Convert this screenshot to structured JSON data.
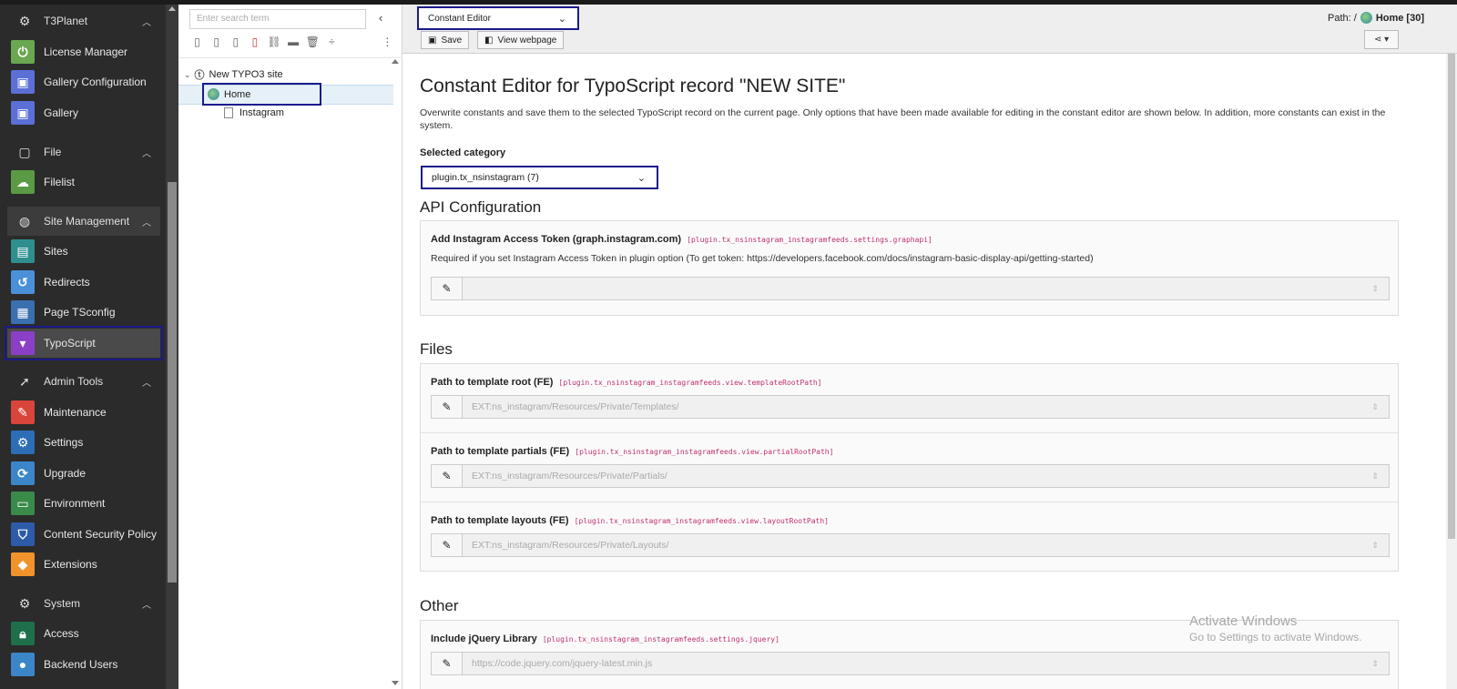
{
  "module_menu": {
    "groups": [
      {
        "label": "T3Planet",
        "icon": "gear-icon"
      },
      {
        "label": "File",
        "icon": "file-icon"
      },
      {
        "label": "Site Management",
        "icon": "globe-icon"
      },
      {
        "label": "Admin Tools",
        "icon": "rocket-icon"
      },
      {
        "label": "System",
        "icon": "gear-icon"
      }
    ],
    "items": [
      {
        "label": "License Manager",
        "icon": "power-icon",
        "color": "#6aa84f"
      },
      {
        "label": "Gallery Configuration",
        "icon": "gallery-icon",
        "color": "#5b6fd6"
      },
      {
        "label": "Gallery",
        "icon": "gallery-icon",
        "color": "#5b6fd6"
      },
      {
        "label": "Filelist",
        "icon": "cloud-icon",
        "color": "#5a9a44"
      },
      {
        "label": "Sites",
        "icon": "sites-icon",
        "color": "#2f8f8f"
      },
      {
        "label": "Redirects",
        "icon": "redirect-icon",
        "color": "#4a90d9"
      },
      {
        "label": "Page TSconfig",
        "icon": "tsconfig-icon",
        "color": "#3a6fb0"
      },
      {
        "label": "TypoScript",
        "icon": "typoscript-icon",
        "color": "#8b3fc7"
      },
      {
        "label": "Maintenance",
        "icon": "wrench-icon",
        "color": "#d9453a"
      },
      {
        "label": "Settings",
        "icon": "gear-icon",
        "color": "#2d6db5"
      },
      {
        "label": "Upgrade",
        "icon": "refresh-icon",
        "color": "#3a86c8"
      },
      {
        "label": "Environment",
        "icon": "monitor-icon",
        "color": "#3a8a4a"
      },
      {
        "label": "Content Security Policy",
        "icon": "shield-icon",
        "color": "#2d5ba8"
      },
      {
        "label": "Extensions",
        "icon": "box-icon",
        "color": "#f0932b"
      },
      {
        "label": "Access",
        "icon": "lock-icon",
        "color": "#1f6f4a"
      },
      {
        "label": "Backend Users",
        "icon": "user-icon",
        "color": "#3a86c8"
      }
    ]
  },
  "page_tree": {
    "search_placeholder": "Enter search term",
    "root": "New TYPO3 site",
    "home": "Home",
    "child": "Instagram"
  },
  "doc_header": {
    "module_select": "Constant Editor",
    "path_label": "Path: /",
    "path_page": "Home [30]",
    "save": "Save",
    "view": "View webpage"
  },
  "content": {
    "title": "Constant Editor for TypoScript record \"NEW SITE\"",
    "intro": "Overwrite constants and save them to the selected TypoScript record on the current page. Only options that have been made available for editing in the constant editor are shown below. In addition, more constants can exist in the system.",
    "category_label": "Selected category",
    "category_value": "plugin.tx_nsinstagram (7)",
    "sections": {
      "api": "API Configuration",
      "files": "Files",
      "other": "Other"
    },
    "fields": {
      "token_title": "Add Instagram Access Token (graph.instagram.com)",
      "token_key": "[plugin.tx_nsinstagram_instagramfeeds.settings.graphapi]",
      "token_desc": "Required if you set Instagram Access Token in plugin option (To get token: https://developers.facebook.com/docs/instagram-basic-display-api/getting-started)",
      "token_value": "",
      "root_title": "Path to template root (FE)",
      "root_key": "[plugin.tx_nsinstagram_instagramfeeds.view.templateRootPath]",
      "root_value": "EXT:ns_instagram/Resources/Private/Templates/",
      "partials_title": "Path to template partials (FE)",
      "partials_key": "[plugin.tx_nsinstagram_instagramfeeds.view.partialRootPath]",
      "partials_value": "EXT:ns_instagram/Resources/Private/Partials/",
      "layouts_title": "Path to template layouts (FE)",
      "layouts_key": "[plugin.tx_nsinstagram_instagramfeeds.view.layoutRootPath]",
      "layouts_value": "EXT:ns_instagram/Resources/Private/Layouts/",
      "jquery_title": "Include jQuery Library",
      "jquery_key": "[plugin.tx_nsinstagram_instagramfeeds.settings.jquery]",
      "jquery_value": "https://code.jquery.com/jquery-latest.min.js"
    }
  },
  "watermark": {
    "line1": "Activate Windows",
    "line2": "Go to Settings to activate Windows."
  }
}
